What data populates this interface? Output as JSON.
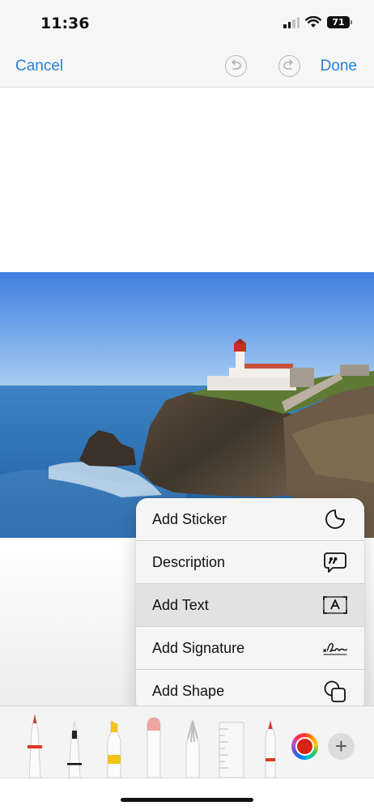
{
  "status_bar": {
    "time": "11:36",
    "battery": "71",
    "icons": [
      "signal-icon",
      "wifi-icon",
      "battery-icon"
    ]
  },
  "nav": {
    "cancel_label": "Cancel",
    "done_label": "Done",
    "undo_icon": "undo-icon",
    "redo_icon": "redo-icon",
    "accent_color": "#2a7ed6"
  },
  "image": {
    "icon": "photo-lighthouse-cliff"
  },
  "menu": {
    "items": [
      {
        "label": "Add Sticker",
        "icon": "sticker-icon"
      },
      {
        "label": "Description",
        "icon": "quote-bubble-icon"
      },
      {
        "label": "Add Text",
        "icon": "text-box-icon",
        "highlighted": true
      },
      {
        "label": "Add Signature",
        "icon": "signature-icon"
      },
      {
        "label": "Add Shape",
        "icon": "shapes-icon"
      }
    ]
  },
  "toolbar": {
    "tools": [
      "pen-tool",
      "fineliner-tool",
      "highlighter-tool",
      "eraser-tool",
      "lasso-tool",
      "ruler-tool",
      "pencil-tool"
    ],
    "selected_color": "#d52412",
    "add_label": "+"
  }
}
